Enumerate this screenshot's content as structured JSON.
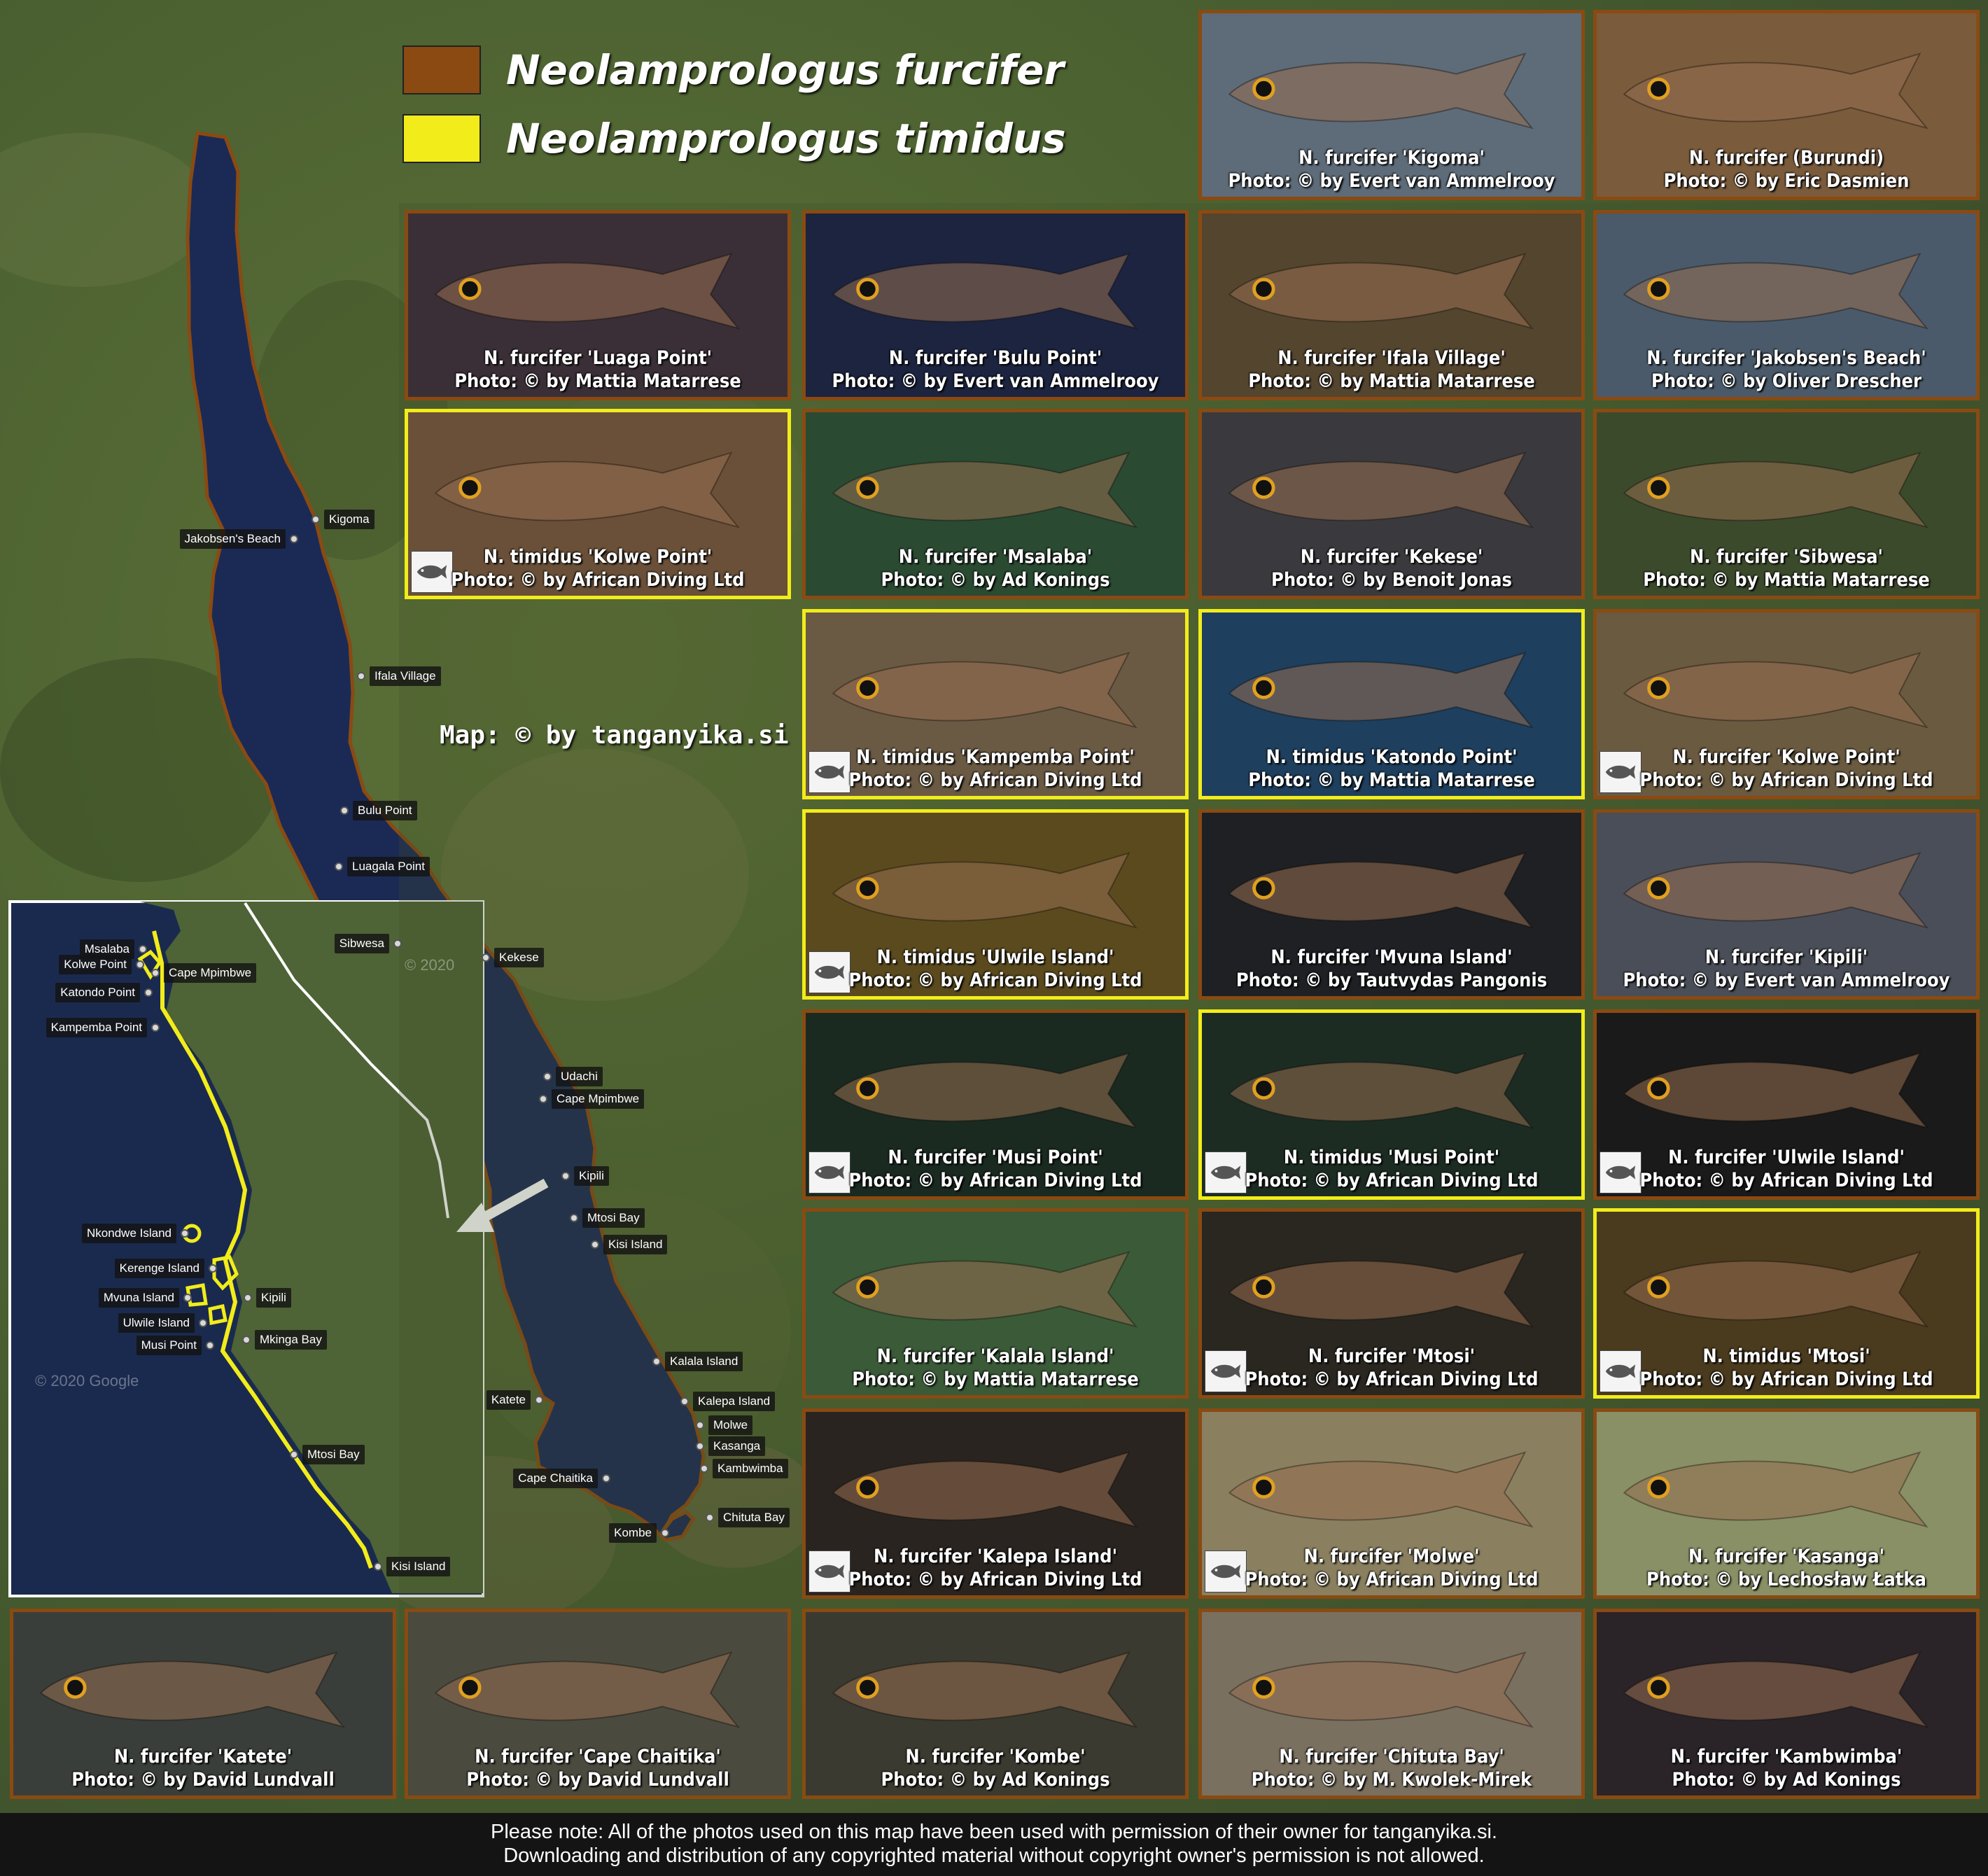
{
  "colors": {
    "furcifer": "#8a4a12",
    "timidus": "#f2ec1a",
    "lake": "#1b2a55",
    "land": "#4d6332"
  },
  "legend": [
    {
      "label": "Neolamprologus furcifer",
      "color": "#8a4a12"
    },
    {
      "label": "Neolamprologus timidus",
      "color": "#f2ec1a"
    }
  ],
  "map_credit": "Map: © by tanganyika.si",
  "watermarks": {
    "main": "© 2020",
    "inset": "© 2020 Google"
  },
  "locations": [
    "Kigoma",
    "Jakobsen's Beach",
    "Ifala Village",
    "Bulu Point",
    "Luagala Point",
    "Sibwesa",
    "Kekese",
    "Udachi",
    "Cape Mpimbwe",
    "Kipili",
    "Mtosi Bay",
    "Kisi Island",
    "Kalala Island",
    "Kalepa Island",
    "Katete",
    "Molwe",
    "Kasanga",
    "Kambwimba",
    "Cape Chaitika",
    "Chituta Bay",
    "Kombe"
  ],
  "inset_locations": [
    "Msalaba",
    "Kolwe Point",
    "Cape Mpimbwe",
    "Katondo Point",
    "Kampemba Point",
    "Nkondwe Island",
    "Kerenge Island",
    "Kipili",
    "Mvuna Island",
    "Ulwile Island",
    "Mkinga Bay",
    "Musi Point",
    "Mtosi Bay",
    "Kisi Island"
  ],
  "photos": [
    {
      "title": "N. furcifer 'Kigoma'",
      "credit": "Photo: © by Evert van Ammelrooy",
      "species": "furcifer",
      "badge": false,
      "bg": "#5e6b78"
    },
    {
      "title": "N. furcifer (Burundi)",
      "credit": "Photo: © by Eric Dasmien",
      "species": "furcifer",
      "badge": false,
      "bg": "#7a5b3c"
    },
    {
      "title": "N. furcifer 'Luaga Point'",
      "credit": "Photo: © by Mattia Matarrese",
      "species": "furcifer",
      "badge": false,
      "bg": "#3a2f36"
    },
    {
      "title": "N. furcifer 'Bulu Point'",
      "credit": "Photo: © by Evert van Ammelrooy",
      "species": "furcifer",
      "badge": false,
      "bg": "#1c2440"
    },
    {
      "title": "N. furcifer 'Ifala Village'",
      "credit": "Photo: © by Mattia Matarrese",
      "species": "furcifer",
      "badge": false,
      "bg": "#54452f"
    },
    {
      "title": "N. furcifer 'Jakobsen's Beach'",
      "credit": "Photo: © by Oliver Drescher",
      "species": "furcifer",
      "badge": false,
      "bg": "#4a5a6a"
    },
    {
      "title": "N. timidus 'Kolwe Point'",
      "credit": "Photo: © by African Diving Ltd",
      "species": "timidus",
      "badge": true,
      "bg": "#6a5038"
    },
    {
      "title": "N. furcifer 'Msalaba'",
      "credit": "Photo: © by Ad Konings",
      "species": "furcifer",
      "badge": false,
      "bg": "#2a4a32"
    },
    {
      "title": "N. furcifer 'Kekese'",
      "credit": "Photo: © by Benoit Jonas",
      "species": "furcifer",
      "badge": false,
      "bg": "#3a3a3e"
    },
    {
      "title": "N. furcifer 'Sibwesa'",
      "credit": "Photo: © by Mattia Matarrese",
      "species": "furcifer",
      "badge": false,
      "bg": "#3c4a2c"
    },
    {
      "title": "N. timidus 'Kampemba Point'",
      "credit": "Photo: © by African Diving Ltd",
      "species": "timidus",
      "badge": true,
      "bg": "#6a5a44"
    },
    {
      "title": "N. timidus 'Katondo Point'",
      "credit": "Photo: © by Mattia Matarrese",
      "species": "timidus",
      "badge": false,
      "bg": "#1e3f5e"
    },
    {
      "title": "N. furcifer 'Kolwe Point'",
      "credit": "Photo: © by African Diving Ltd",
      "species": "furcifer",
      "badge": true,
      "bg": "#6a5a40"
    },
    {
      "title": "N. timidus 'Ulwile Island'",
      "credit": "Photo: © by African Diving Ltd",
      "species": "timidus",
      "badge": true,
      "bg": "#5a4a1e"
    },
    {
      "title": "N. furcifer 'Mvuna Island'",
      "credit": "Photo: © by Tautvydas Pangonis",
      "species": "furcifer",
      "badge": false,
      "bg": "#1e2024"
    },
    {
      "title": "N. furcifer 'Kipili'",
      "credit": "Photo: © by Evert van Ammelrooy",
      "species": "furcifer",
      "badge": false,
      "bg": "#4a4e58"
    },
    {
      "title": "N. furcifer 'Musi Point'",
      "credit": "Photo: © by African Diving Ltd",
      "species": "furcifer",
      "badge": true,
      "bg": "#1a2a20"
    },
    {
      "title": "N. timidus 'Musi Point'",
      "credit": "Photo: © by African Diving Ltd",
      "species": "timidus",
      "badge": true,
      "bg": "#1c2c22"
    },
    {
      "title": "N. furcifer 'Ulwile Island'",
      "credit": "Photo: © by African Diving Ltd",
      "species": "furcifer",
      "badge": true,
      "bg": "#1a1a1a"
    },
    {
      "title": "N. furcifer 'Kalala Island'",
      "credit": "Photo: © by Mattia Matarrese",
      "species": "furcifer",
      "badge": false,
      "bg": "#3a5a38"
    },
    {
      "title": "N. furcifer 'Mtosi'",
      "credit": "Photo: © by African Diving Ltd",
      "species": "furcifer",
      "badge": true,
      "bg": "#2a2620"
    },
    {
      "title": "N. timidus 'Mtosi'",
      "credit": "Photo: © by African Diving Ltd",
      "species": "timidus",
      "badge": true,
      "bg": "#4a3a1e"
    },
    {
      "title": "N. furcifer 'Kalepa Island'",
      "credit": "Photo: © by African Diving Ltd",
      "species": "furcifer",
      "badge": true,
      "bg": "#2a2420"
    },
    {
      "title": "N. furcifer 'Molwe'",
      "credit": "Photo: © by African Diving Ltd",
      "species": "furcifer",
      "badge": true,
      "bg": "#8a8060"
    },
    {
      "title": "N. furcifer 'Kasanga'",
      "credit": "Photo: © by Lechosław Łatka",
      "species": "furcifer",
      "badge": false,
      "bg": "#8a9066"
    },
    {
      "title": "N. furcifer 'Katete'",
      "credit": "Photo: © by David Lundvall",
      "species": "furcifer",
      "badge": false,
      "bg": "#3a3e3a"
    },
    {
      "title": "N. furcifer 'Cape Chaitika'",
      "credit": "Photo: © by David Lundvall",
      "species": "furcifer",
      "badge": false,
      "bg": "#4a4a3e"
    },
    {
      "title": "N. furcifer 'Kombe'",
      "credit": "Photo: © by Ad Konings",
      "species": "furcifer",
      "badge": false,
      "bg": "#3a3a30"
    },
    {
      "title": "N. furcifer 'Chituta Bay'",
      "credit": "Photo: © by M. Kwolek-Mirek",
      "species": "furcifer",
      "badge": false,
      "bg": "#7a7060"
    },
    {
      "title": "N. furcifer 'Kambwimba'",
      "credit": "Photo: © by Ad Konings",
      "species": "furcifer",
      "badge": false,
      "bg": "#2a2428"
    }
  ],
  "footer": [
    "Please note: All of the photos used on this map have been used with permission of their owner for tanganyika.si.",
    "Downloading and distribution of any copyrighted material without copyright owner's permission is not allowed."
  ]
}
